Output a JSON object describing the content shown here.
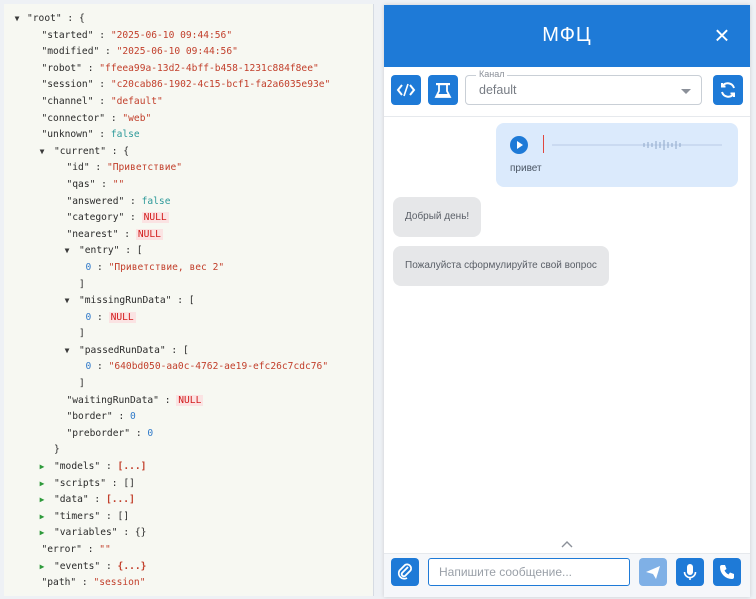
{
  "json_tree": [
    {
      "d": 0,
      "t": "exp",
      "k": "\"root\"",
      "p": " : {"
    },
    {
      "d": 1,
      "k": "\"started\"",
      "p": " : ",
      "v": "\"2025-06-10 09:44:56\"",
      "vt": "s"
    },
    {
      "d": 1,
      "k": "\"modified\"",
      "p": " : ",
      "v": "\"2025-06-10 09:44:56\"",
      "vt": "s"
    },
    {
      "d": 1,
      "k": "\"robot\"",
      "p": " : ",
      "v": "\"ffeea99a-13d2-4bff-b458-1231c884f8ee\"",
      "vt": "s"
    },
    {
      "d": 1,
      "k": "\"session\"",
      "p": " : ",
      "v": "\"c20cab86-1902-4c15-bcf1-fa2a6035e93e\"",
      "vt": "s"
    },
    {
      "d": 1,
      "k": "\"channel\"",
      "p": " : ",
      "v": "\"default\"",
      "vt": "s"
    },
    {
      "d": 1,
      "k": "\"connector\"",
      "p": " : ",
      "v": "\"web\"",
      "vt": "s"
    },
    {
      "d": 1,
      "k": "\"unknown\"",
      "p": " : ",
      "v": "false",
      "vt": "b"
    },
    {
      "d": 2,
      "t": "exp",
      "k": "\"current\"",
      "p": " : {"
    },
    {
      "d": 3,
      "k": "\"id\"",
      "p": " : ",
      "v": "\"Приветствие\"",
      "vt": "s"
    },
    {
      "d": 3,
      "k": "\"qas\"",
      "p": " : ",
      "v": "\"\"",
      "vt": "s"
    },
    {
      "d": 3,
      "k": "\"answered\"",
      "p": " : ",
      "v": "false",
      "vt": "b"
    },
    {
      "d": 3,
      "k": "\"category\"",
      "p": " : ",
      "v": "NULL",
      "vt": "nul"
    },
    {
      "d": 3,
      "k": "\"nearest\"",
      "p": " : ",
      "v": "NULL",
      "vt": "nul"
    },
    {
      "d": 4,
      "t": "exp",
      "k": "\"entry\"",
      "p": " : ["
    },
    {
      "d": 5,
      "k": "0",
      "p": " : ",
      "v": "\"Приветствие, вес 2\"",
      "vt": "s",
      "idx": true
    },
    {
      "d": 4,
      "k": "]",
      "br": true
    },
    {
      "d": 4,
      "t": "exp",
      "k": "\"missingRunData\"",
      "p": " : ["
    },
    {
      "d": 5,
      "k": "0",
      "p": " : ",
      "v": "NULL",
      "vt": "nul",
      "idx": true
    },
    {
      "d": 4,
      "k": "]",
      "br": true
    },
    {
      "d": 4,
      "t": "exp",
      "k": "\"passedRunData\"",
      "p": " : ["
    },
    {
      "d": 5,
      "k": "0",
      "p": " : ",
      "v": "\"640bd050-aa0c-4762-ae19-efc26c7cdc76\"",
      "vt": "s",
      "idx": true
    },
    {
      "d": 4,
      "k": "]",
      "br": true
    },
    {
      "d": 3,
      "k": "\"waitingRunData\"",
      "p": " : ",
      "v": "NULL",
      "vt": "nul"
    },
    {
      "d": 3,
      "k": "\"border\"",
      "p": " : ",
      "v": "0",
      "vt": "n"
    },
    {
      "d": 3,
      "k": "\"preborder\"",
      "p": " : ",
      "v": "0",
      "vt": "n"
    },
    {
      "d": 2,
      "k": "}",
      "br": true
    },
    {
      "d": 2,
      "t": "col",
      "k": "\"models\"",
      "p": " : ",
      "v": "[...]",
      "vt": "dots"
    },
    {
      "d": 2,
      "t": "col",
      "k": "\"scripts\"",
      "p": " : ",
      "v": "[]",
      "vt": "k"
    },
    {
      "d": 2,
      "t": "col",
      "k": "\"data\"",
      "p": " : ",
      "v": "[...]",
      "vt": "dots"
    },
    {
      "d": 2,
      "t": "col",
      "k": "\"timers\"",
      "p": " : ",
      "v": "[]",
      "vt": "k"
    },
    {
      "d": 2,
      "t": "col",
      "k": "\"variables\"",
      "p": " : ",
      "v": "{}",
      "vt": "k"
    },
    {
      "d": 1,
      "k": "\"error\"",
      "p": " : ",
      "v": "\"\"",
      "vt": "s"
    },
    {
      "d": 2,
      "t": "col",
      "k": "\"events\"",
      "p": " : ",
      "v": "{...}",
      "vt": "dots"
    },
    {
      "d": 1,
      "k": "\"path\"",
      "p": " : ",
      "v": "\"session\"",
      "vt": "s"
    }
  ],
  "chat": {
    "title": "МФЦ",
    "close_icon": "×",
    "channel_label": "Канал",
    "channel_value": "default",
    "voice_message_text": "привет",
    "bot_messages": [
      "Добрый день!",
      "Пожалуйста сформулируйте свой вопрос"
    ],
    "input_placeholder": "Напишите сообщение..."
  },
  "colors": {
    "accent": "#1e7ad7",
    "bubble_user": "#dbeafc",
    "bubble_bot": "#e6e7e9"
  }
}
